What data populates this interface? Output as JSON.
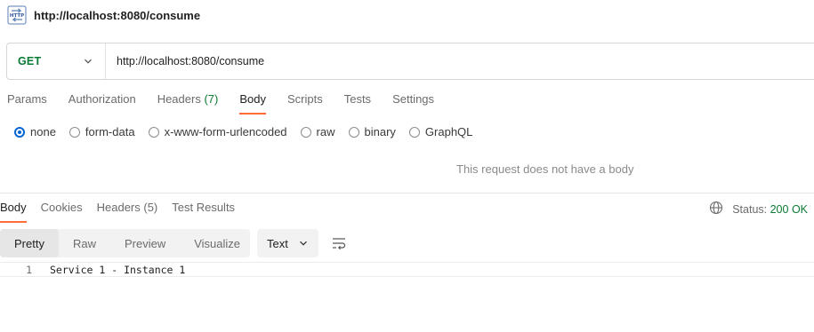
{
  "title": {
    "icon": "http-request-icon",
    "text": "http://localhost:8080/consume"
  },
  "request": {
    "method": "GET",
    "url": "http://localhost:8080/consume"
  },
  "request_tabs": [
    {
      "label": "Params",
      "count": ""
    },
    {
      "label": "Authorization",
      "count": ""
    },
    {
      "label": "Headers",
      "count": "(7)"
    },
    {
      "label": "Body",
      "count": "",
      "active": true
    },
    {
      "label": "Scripts",
      "count": ""
    },
    {
      "label": "Tests",
      "count": ""
    },
    {
      "label": "Settings",
      "count": ""
    }
  ],
  "body_options": [
    {
      "label": "none",
      "checked": true
    },
    {
      "label": "form-data"
    },
    {
      "label": "x-www-form-urlencoded"
    },
    {
      "label": "raw"
    },
    {
      "label": "binary"
    },
    {
      "label": "GraphQL"
    }
  ],
  "no_body_message": "This request does not have a body",
  "response_tabs": [
    {
      "label": "Body",
      "active": true
    },
    {
      "label": "Cookies"
    },
    {
      "label": "Headers (5)"
    },
    {
      "label": "Test Results"
    }
  ],
  "status": {
    "icon": "globe-icon",
    "label": "Status:",
    "value": "200 OK",
    "value_color": "#0a7a34"
  },
  "view_modes": [
    {
      "label": "Pretty",
      "active": true
    },
    {
      "label": "Raw"
    },
    {
      "label": "Preview"
    },
    {
      "label": "Visualize"
    }
  ],
  "format": {
    "selected": "Text"
  },
  "response_body": [
    {
      "line": "1",
      "text": "Service 1 - Instance 1"
    }
  ],
  "colors": {
    "accent_tab": "#ff6c37",
    "method_get": "#0a7a34",
    "radio_selected": "#0265d2"
  }
}
